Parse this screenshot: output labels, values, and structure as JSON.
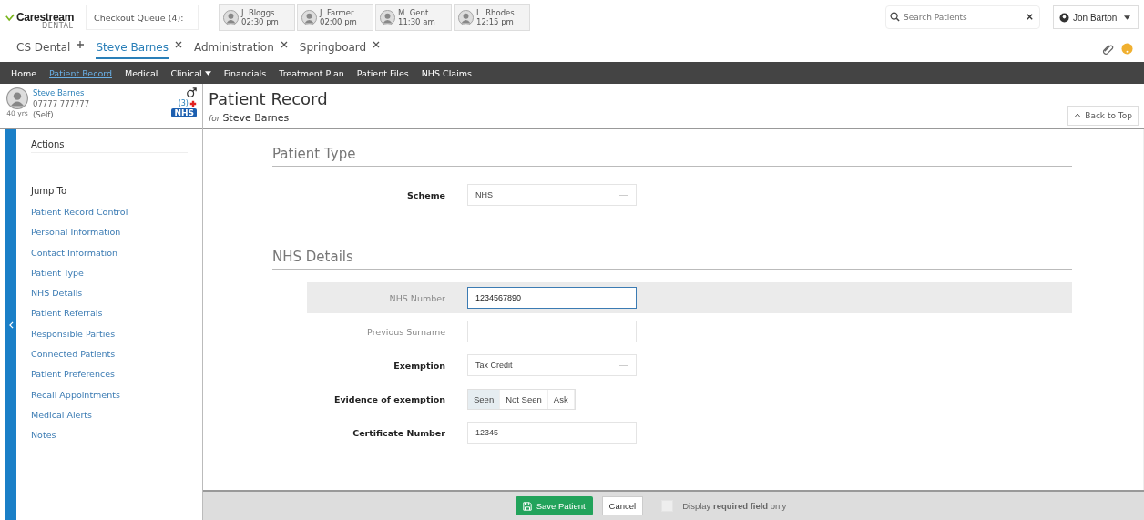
{
  "brand": {
    "name": "Carestream",
    "sub": "DENTAL"
  },
  "checkout": {
    "label": "Checkout Queue (4):"
  },
  "queue": [
    {
      "name": "J. Bloggs",
      "time": "02:30 pm"
    },
    {
      "name": "J. Farmer",
      "time": "02:00 pm"
    },
    {
      "name": "M. Gent",
      "time": "11:30 am"
    },
    {
      "name": "L. Rhodes",
      "time": "12:15 pm"
    }
  ],
  "search": {
    "placeholder": "Search Patients"
  },
  "user": {
    "name": "Jon Barton"
  },
  "tabs": [
    {
      "label": "CS Dental",
      "kind": "add",
      "selected": false
    },
    {
      "label": "Steve Barnes",
      "kind": "close",
      "selected": true
    },
    {
      "label": "Administration",
      "kind": "close",
      "selected": false
    },
    {
      "label": "Springboard",
      "kind": "close",
      "selected": false
    }
  ],
  "nav": [
    {
      "label": "Home",
      "selected": false,
      "dropdown": false
    },
    {
      "label": "Patient Record",
      "selected": true,
      "dropdown": false
    },
    {
      "label": "Medical",
      "selected": false,
      "dropdown": false
    },
    {
      "label": "Clinical",
      "selected": false,
      "dropdown": true
    },
    {
      "label": "Financials",
      "selected": false,
      "dropdown": false
    },
    {
      "label": "Treatment Plan",
      "selected": false,
      "dropdown": false
    },
    {
      "label": "Patient Files",
      "selected": false,
      "dropdown": false
    },
    {
      "label": "NHS Claims",
      "selected": false,
      "dropdown": false
    }
  ],
  "patient": {
    "name": "Steve Barnes",
    "phone": "07777 777777",
    "age": "40 yrs",
    "relation": "(Self)",
    "alerts": "(3)",
    "badge": "NHS"
  },
  "page": {
    "title": "Patient Record",
    "subtitle_prefix": "for",
    "subtitle": "Steve Barnes",
    "back": "Back to Top"
  },
  "sidebar": {
    "actions_heading": "Actions",
    "jump_heading": "Jump To",
    "items": [
      "Patient Record Control",
      "Personal Information",
      "Contact Information",
      "Patient Type",
      "NHS Details",
      "Patient Referrals",
      "Responsible Parties",
      "Connected Patients",
      "Patient Preferences",
      "Recall Appointments",
      "Medical Alerts",
      "Notes"
    ]
  },
  "sections": [
    {
      "title": "Patient Type",
      "fields": [
        {
          "label": "Scheme",
          "kind": "dropdown",
          "value": "NHS",
          "required": true,
          "focused": false
        }
      ]
    },
    {
      "title": "NHS Details",
      "fields": [
        {
          "label": "NHS Number",
          "kind": "input",
          "value": "1234567890",
          "required": false,
          "focused": true
        },
        {
          "label": "Previous Surname",
          "kind": "input",
          "required": false,
          "focused": false
        },
        {
          "label": "Exemption",
          "kind": "dropdown",
          "value": "Tax Credit",
          "required": true,
          "focused": false
        },
        {
          "label": "Evidence of exemption",
          "kind": "toggle",
          "required": true,
          "focused": false,
          "options": [
            {
              "label": "Seen",
              "selected": true
            },
            {
              "label": "Not Seen",
              "selected": false
            },
            {
              "label": "Ask",
              "selected": false
            }
          ]
        },
        {
          "label": "Certificate Number",
          "kind": "input",
          "value": "12345",
          "required": true,
          "focused": false
        }
      ]
    }
  ],
  "footer": {
    "save": "Save Patient",
    "cancel": "Cancel",
    "required_only": {
      "text": "Display **required field** only",
      "checked": false
    }
  }
}
